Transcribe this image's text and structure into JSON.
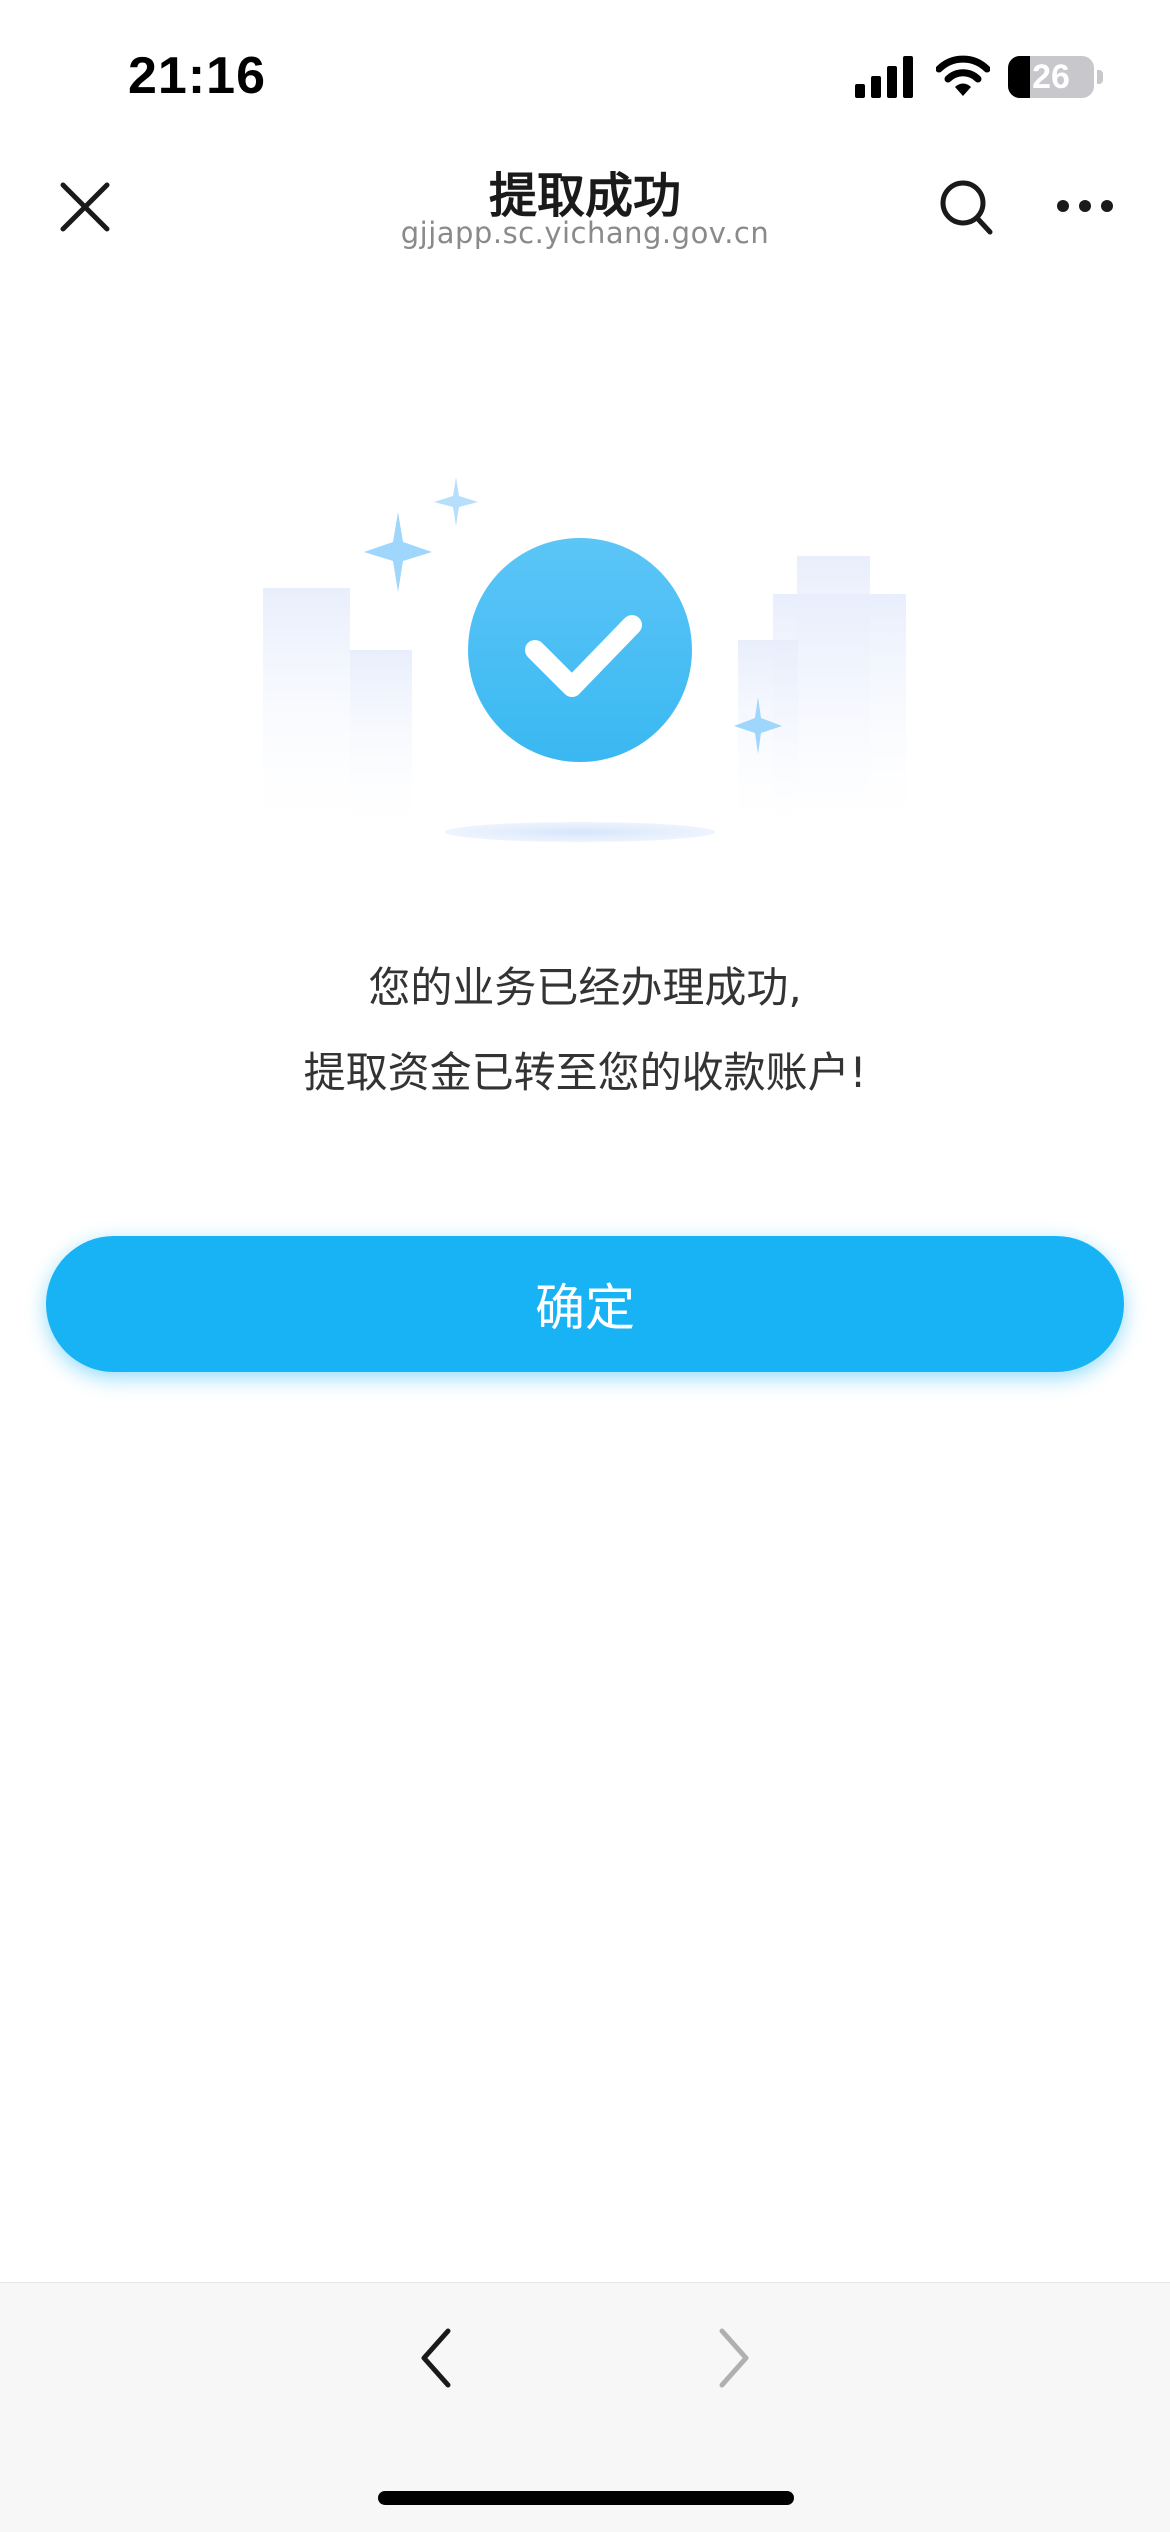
{
  "status_bar": {
    "time": "21:16",
    "battery_level": "26",
    "battery_fraction": 0.26,
    "icons": [
      "signal-icon",
      "wifi-icon",
      "battery-icon"
    ]
  },
  "nav": {
    "title": "提取成功",
    "subtitle": "gjjapp.sc.yichang.gov.cn",
    "icons": [
      "close-icon",
      "search-icon",
      "more-icon"
    ]
  },
  "illustration": {
    "icon": "success-check-icon",
    "accent_color": "#3fbef5"
  },
  "message": {
    "line1": "您的业务已经办理成功,",
    "line2": "提取资金已转至您的收款账户!"
  },
  "confirm_button": {
    "label": "确定",
    "color": "#17b3f4"
  },
  "bottom_toolbar": {
    "icons": [
      "back-arrow-icon",
      "forward-arrow-icon"
    ]
  }
}
